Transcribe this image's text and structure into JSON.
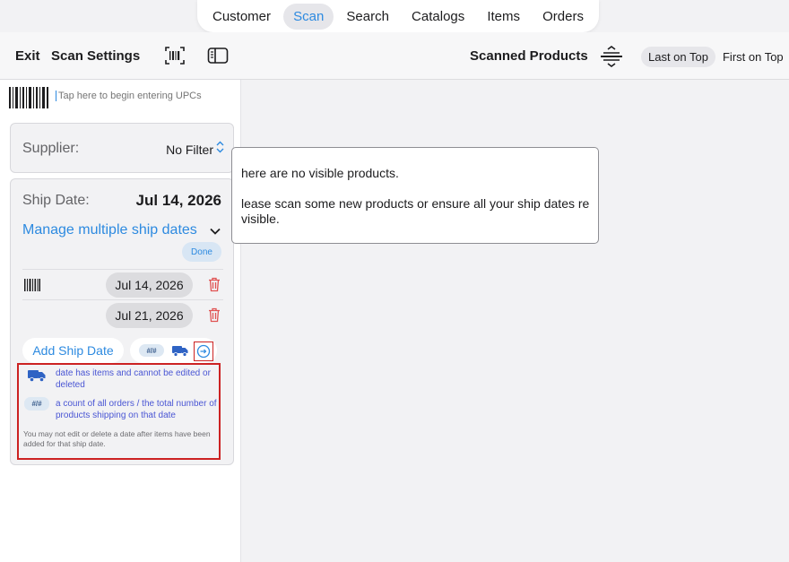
{
  "tabs": [
    {
      "label": "Customer"
    },
    {
      "label": "Scan"
    },
    {
      "label": "Search"
    },
    {
      "label": "Catalogs"
    },
    {
      "label": "Items"
    },
    {
      "label": "Orders"
    }
  ],
  "active_tab": "Scan",
  "toolbar": {
    "exit_label": "Exit",
    "settings_label": "Scan Settings",
    "scanned_title": "Scanned Products",
    "sort_options": [
      "Last on Top",
      "First on Top"
    ],
    "sort_selected": "Last on Top"
  },
  "panel": {
    "upc_placeholder": "Tap here to begin entering UPCs",
    "supplier_label": "Supplier:",
    "supplier_value": "No Filter",
    "ship_date_label": "Ship Date:",
    "ship_date_value": "Jul 14, 2026",
    "manage_label": "Manage multiple ship dates",
    "done_label": "Done",
    "dates": [
      "Jul 14, 2026",
      "Jul 21, 2026"
    ],
    "add_label": "Add Ship Date",
    "count_badge": "#/#",
    "legend": {
      "truck_text": "date has items and cannot be edited or deleted",
      "count_text": "a count of all orders / the total number of products shipping on that date",
      "note": "You may not edit or delete a date after items have been added for that ship date."
    }
  },
  "message": {
    "line1": "here are no visible products.",
    "line2": "lease scan some new products or ensure all your ship dates re visible."
  },
  "colors": {
    "accent": "#2d8ae0",
    "highlight_border": "#cc2222",
    "delete": "#e05252",
    "legend_text": "#4a56d4"
  }
}
